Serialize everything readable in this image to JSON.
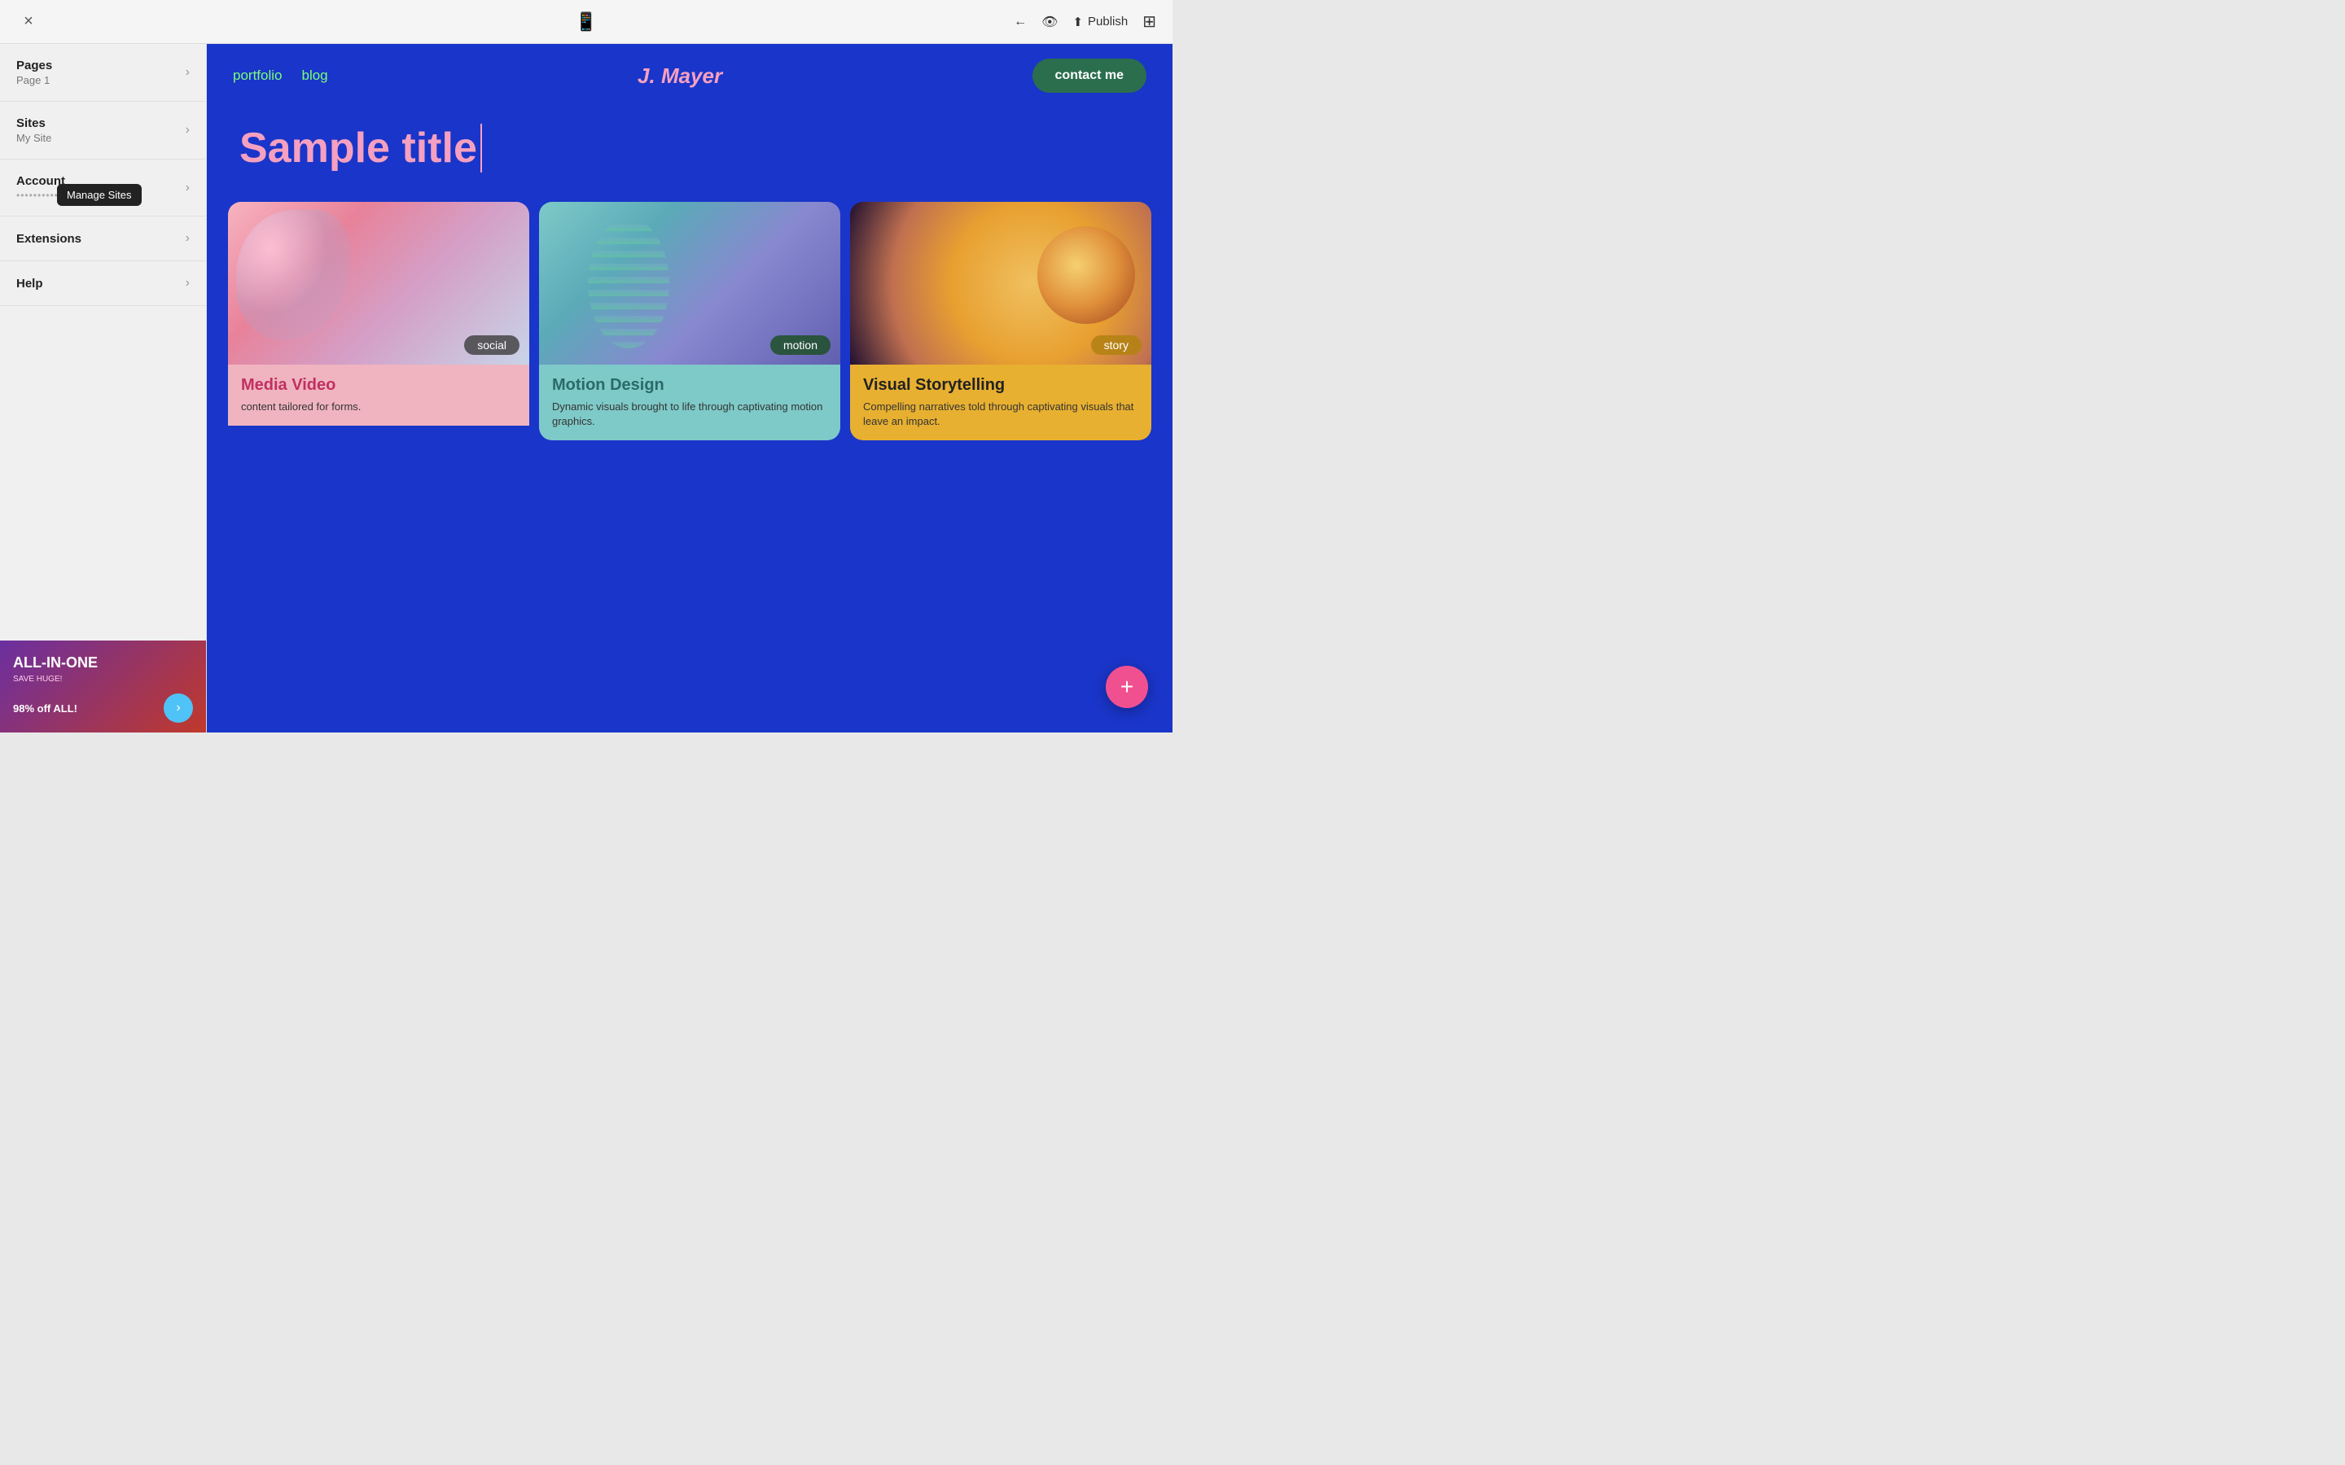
{
  "topBar": {
    "closeLabel": "×",
    "phoneIconLabel": "📱",
    "backIconLabel": "←",
    "previewIconLabel": "👁",
    "publishLabel": "Publish",
    "layoutIconLabel": "⊞"
  },
  "sidebar": {
    "items": [
      {
        "id": "pages",
        "title": "Pages",
        "subtitle": "Page 1",
        "email": ""
      },
      {
        "id": "sites",
        "title": "Sites",
        "subtitle": "My Site",
        "email": ""
      },
      {
        "id": "account",
        "title": "Account",
        "subtitle": "",
        "email": "••••••••••@•••.••"
      },
      {
        "id": "extensions",
        "title": "Extensions",
        "subtitle": "",
        "email": ""
      },
      {
        "id": "help",
        "title": "Help",
        "subtitle": "",
        "email": ""
      }
    ],
    "manageSitesTooltip": "Manage Sites"
  },
  "promo": {
    "title": "ALL-IN-ONE",
    "subtitle": "SAVE HUGE!",
    "discount": "98% off ALL!",
    "arrowLabel": "›"
  },
  "sitePreview": {
    "nav": {
      "links": [
        "portfolio",
        "blog"
      ],
      "logo": "J. Mayer",
      "contactBtn": "contact me"
    },
    "heroTitle": "Sample title",
    "cards": [
      {
        "id": "social",
        "tag": "social",
        "title": "Media Video",
        "description": "content tailored for forms."
      },
      {
        "id": "motion",
        "tag": "motion",
        "title": "Motion Design",
        "description": "Dynamic visuals brought to life through captivating motion graphics."
      },
      {
        "id": "story",
        "tag": "story",
        "title": "Visual Storytelling",
        "description": "Compelling narratives told through captivating visuals that leave an impact."
      }
    ]
  },
  "fab": {
    "label": "+"
  }
}
